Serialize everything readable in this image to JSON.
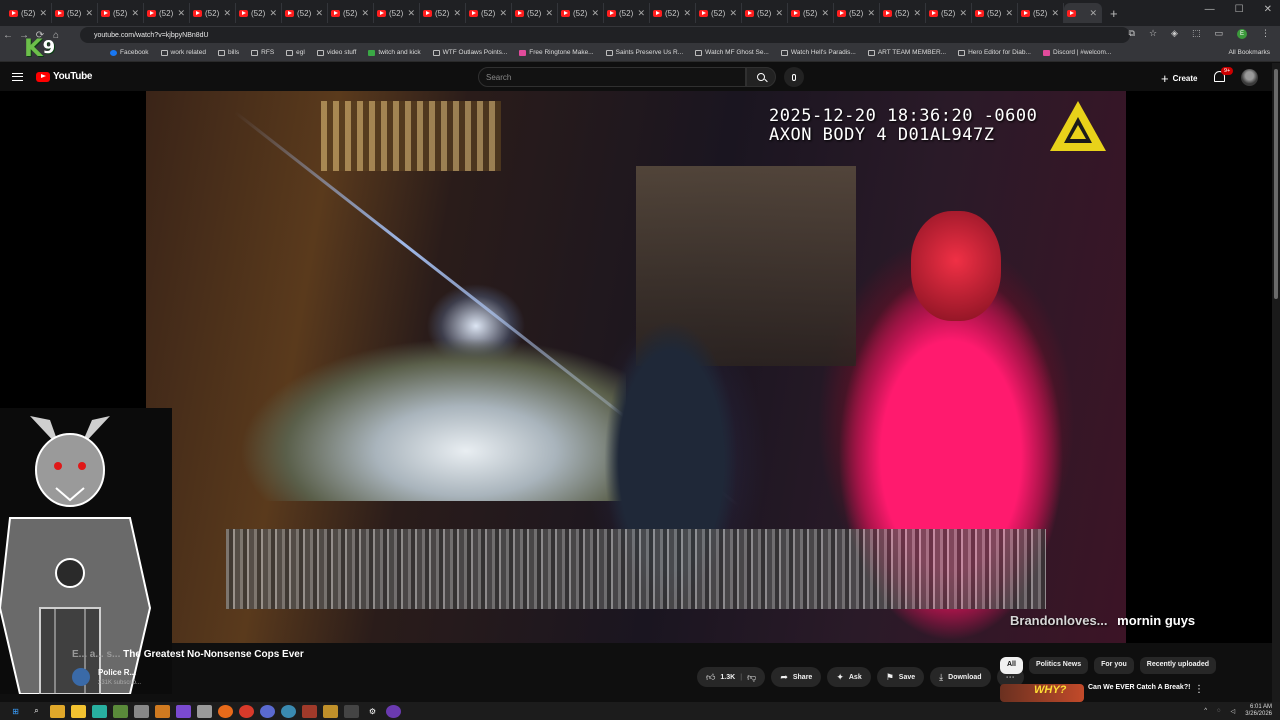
{
  "browser": {
    "tab_label": "(52)",
    "tab_count": 23,
    "url": "youtube.com/watch?v=kjbpyNBn8dU",
    "bookmarks": [
      "Facebook",
      "work related",
      "bills",
      "RFS",
      "egl",
      "video stuff",
      "twitch and kick",
      "WTF Outlaws Points...",
      "Free Ringtone Make...",
      "Saints Preserve Us R...",
      "Watch MF Ghost Se...",
      "Watch Hell's Paradis...",
      "ART TEAM MEMBER...",
      "Hero Editor for Diab...",
      "Discord | #welcom..."
    ],
    "all_bookmarks": "All Bookmarks"
  },
  "overlay": {
    "logo_k": "K",
    "logo_9": "9"
  },
  "youtube": {
    "logo_text": "YouTube",
    "search_placeholder": "Search",
    "create_label": "Create",
    "notif_badge": "9+"
  },
  "video": {
    "timestamp_line1": "2025-12-20 18:36:20 -0600",
    "timestamp_line2": "AXON BODY 4 D01AL947Z",
    "chat_user": "Brandonloves...",
    "chat_message": "mornin guys"
  },
  "info": {
    "title_partial": "The Greatest No-Nonsense Cops Ever",
    "title_prefix": "E... a... s...",
    "channel_name": "Police R...",
    "channel_subs": "231K subscrib...",
    "likes": "1.3K",
    "share": "Share",
    "ask": "Ask",
    "save": "Save",
    "download": "Download"
  },
  "chips": [
    "All",
    "Politics News",
    "For you",
    "Recently uploaded"
  ],
  "recommended": {
    "thumb_text": "WHY?",
    "title": "Can We EVER Catch A Break?!"
  },
  "taskbar": {
    "time": "6:01 AM",
    "date": "3/26/2026"
  }
}
